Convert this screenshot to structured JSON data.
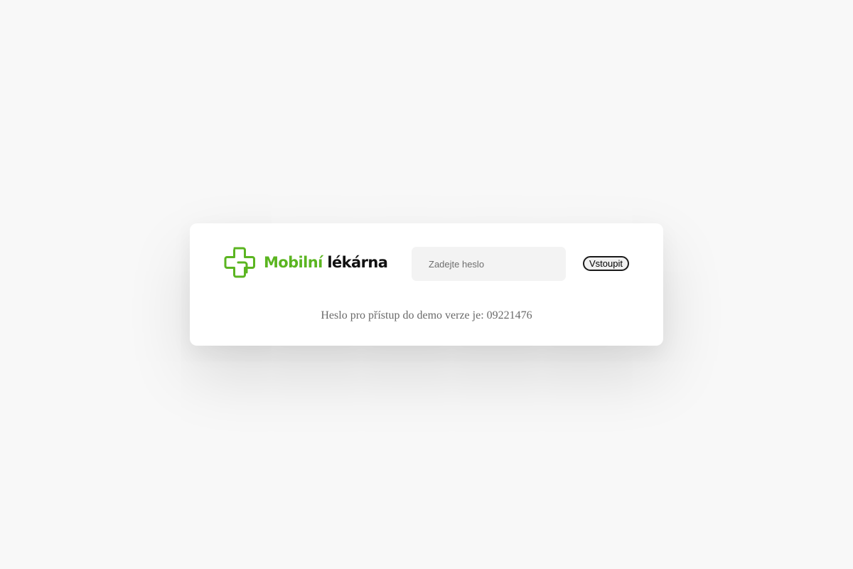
{
  "brand": {
    "name_part1": "Mobilní",
    "name_part2": "lékárna",
    "logo_icon": "pharmacy-cross-icon",
    "colors": {
      "green": "#5bb521",
      "dark": "#111111"
    }
  },
  "login": {
    "password_placeholder": "Zadejte heslo",
    "password_value": "",
    "submit_label": "Vstoupit",
    "hint": "Heslo pro přístup do demo verze je: 09221476"
  }
}
